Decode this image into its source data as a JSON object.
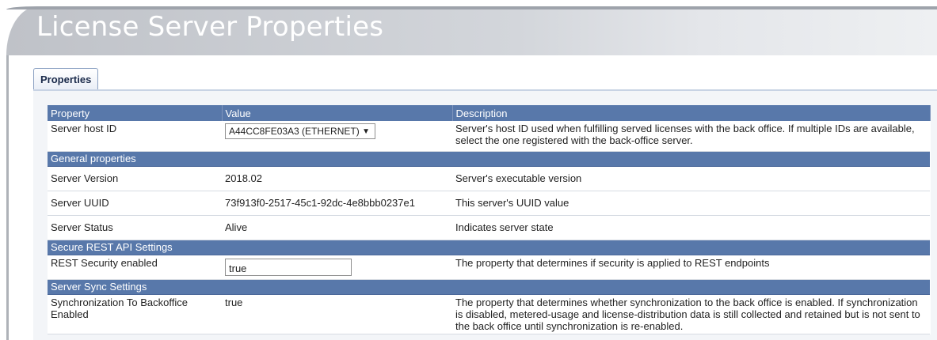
{
  "page": {
    "title": "License Server Properties"
  },
  "tabs": [
    {
      "label": "Properties",
      "active": true
    }
  ],
  "table": {
    "headers": {
      "property": "Property",
      "value": "Value",
      "description": "Description"
    },
    "server_host_id": {
      "property": "Server host ID",
      "selected": "A44CC8FE03A3 (ETHERNET)",
      "description": "Server's host ID used when fulfilling served licenses with the back office. If multiple IDs are available, select the one registered with the back-office server."
    },
    "general": {
      "label": "General properties",
      "rows": [
        {
          "property": "Server Version",
          "value": "2018.02",
          "description": "Server's executable version"
        },
        {
          "property": "Server UUID",
          "value": "73f913f0-2517-45c1-92dc-4e8bbb0237e1",
          "description": "This server's UUID value"
        },
        {
          "property": "Server Status",
          "value": "Alive",
          "description": "Indicates server state"
        }
      ]
    },
    "rest": {
      "label": "Secure REST API Settings",
      "row": {
        "property": "REST Security enabled",
        "value": "true",
        "description": "The property that determines if security is applied to REST endpoints"
      }
    },
    "sync": {
      "label": "Server Sync Settings",
      "row": {
        "property": "Synchronization To Backoffice Enabled",
        "value": "true",
        "description": "The property that determines whether synchronization to the back office is enabled. If synchronization is disabled, metered-usage and license-distribution data is still collected and retained but is not sent to the back office until synchronization is re-enabled."
      }
    }
  },
  "colors": {
    "header_bar": "#5878aa",
    "tab_border": "#8aa0c2"
  }
}
